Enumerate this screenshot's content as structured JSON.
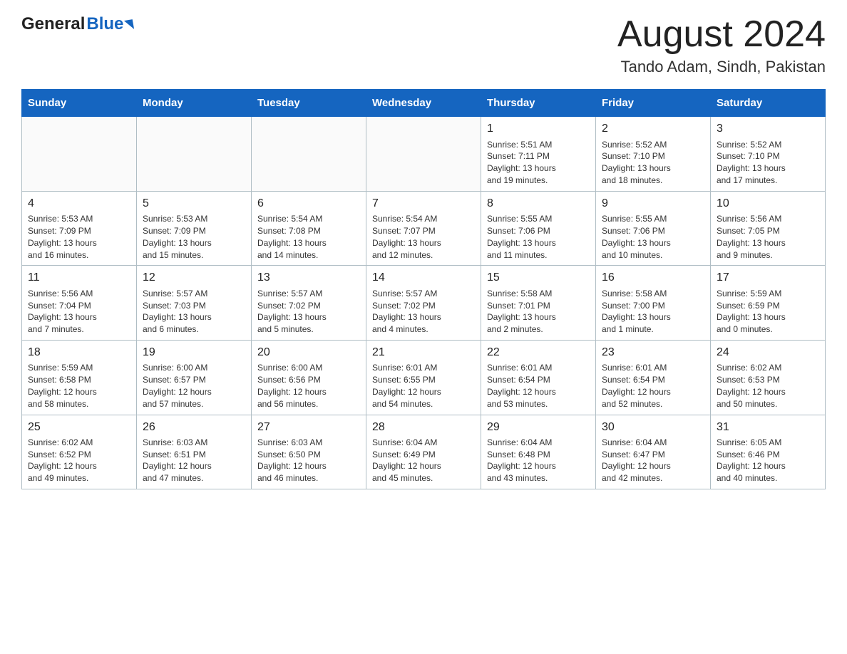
{
  "header": {
    "logo_general": "General",
    "logo_blue": "Blue",
    "month_title": "August 2024",
    "location": "Tando Adam, Sindh, Pakistan"
  },
  "days_of_week": [
    "Sunday",
    "Monday",
    "Tuesday",
    "Wednesday",
    "Thursday",
    "Friday",
    "Saturday"
  ],
  "weeks": [
    {
      "days": [
        {
          "num": "",
          "info": ""
        },
        {
          "num": "",
          "info": ""
        },
        {
          "num": "",
          "info": ""
        },
        {
          "num": "",
          "info": ""
        },
        {
          "num": "1",
          "info": "Sunrise: 5:51 AM\nSunset: 7:11 PM\nDaylight: 13 hours\nand 19 minutes."
        },
        {
          "num": "2",
          "info": "Sunrise: 5:52 AM\nSunset: 7:10 PM\nDaylight: 13 hours\nand 18 minutes."
        },
        {
          "num": "3",
          "info": "Sunrise: 5:52 AM\nSunset: 7:10 PM\nDaylight: 13 hours\nand 17 minutes."
        }
      ]
    },
    {
      "days": [
        {
          "num": "4",
          "info": "Sunrise: 5:53 AM\nSunset: 7:09 PM\nDaylight: 13 hours\nand 16 minutes."
        },
        {
          "num": "5",
          "info": "Sunrise: 5:53 AM\nSunset: 7:09 PM\nDaylight: 13 hours\nand 15 minutes."
        },
        {
          "num": "6",
          "info": "Sunrise: 5:54 AM\nSunset: 7:08 PM\nDaylight: 13 hours\nand 14 minutes."
        },
        {
          "num": "7",
          "info": "Sunrise: 5:54 AM\nSunset: 7:07 PM\nDaylight: 13 hours\nand 12 minutes."
        },
        {
          "num": "8",
          "info": "Sunrise: 5:55 AM\nSunset: 7:06 PM\nDaylight: 13 hours\nand 11 minutes."
        },
        {
          "num": "9",
          "info": "Sunrise: 5:55 AM\nSunset: 7:06 PM\nDaylight: 13 hours\nand 10 minutes."
        },
        {
          "num": "10",
          "info": "Sunrise: 5:56 AM\nSunset: 7:05 PM\nDaylight: 13 hours\nand 9 minutes."
        }
      ]
    },
    {
      "days": [
        {
          "num": "11",
          "info": "Sunrise: 5:56 AM\nSunset: 7:04 PM\nDaylight: 13 hours\nand 7 minutes."
        },
        {
          "num": "12",
          "info": "Sunrise: 5:57 AM\nSunset: 7:03 PM\nDaylight: 13 hours\nand 6 minutes."
        },
        {
          "num": "13",
          "info": "Sunrise: 5:57 AM\nSunset: 7:02 PM\nDaylight: 13 hours\nand 5 minutes."
        },
        {
          "num": "14",
          "info": "Sunrise: 5:57 AM\nSunset: 7:02 PM\nDaylight: 13 hours\nand 4 minutes."
        },
        {
          "num": "15",
          "info": "Sunrise: 5:58 AM\nSunset: 7:01 PM\nDaylight: 13 hours\nand 2 minutes."
        },
        {
          "num": "16",
          "info": "Sunrise: 5:58 AM\nSunset: 7:00 PM\nDaylight: 13 hours\nand 1 minute."
        },
        {
          "num": "17",
          "info": "Sunrise: 5:59 AM\nSunset: 6:59 PM\nDaylight: 13 hours\nand 0 minutes."
        }
      ]
    },
    {
      "days": [
        {
          "num": "18",
          "info": "Sunrise: 5:59 AM\nSunset: 6:58 PM\nDaylight: 12 hours\nand 58 minutes."
        },
        {
          "num": "19",
          "info": "Sunrise: 6:00 AM\nSunset: 6:57 PM\nDaylight: 12 hours\nand 57 minutes."
        },
        {
          "num": "20",
          "info": "Sunrise: 6:00 AM\nSunset: 6:56 PM\nDaylight: 12 hours\nand 56 minutes."
        },
        {
          "num": "21",
          "info": "Sunrise: 6:01 AM\nSunset: 6:55 PM\nDaylight: 12 hours\nand 54 minutes."
        },
        {
          "num": "22",
          "info": "Sunrise: 6:01 AM\nSunset: 6:54 PM\nDaylight: 12 hours\nand 53 minutes."
        },
        {
          "num": "23",
          "info": "Sunrise: 6:01 AM\nSunset: 6:54 PM\nDaylight: 12 hours\nand 52 minutes."
        },
        {
          "num": "24",
          "info": "Sunrise: 6:02 AM\nSunset: 6:53 PM\nDaylight: 12 hours\nand 50 minutes."
        }
      ]
    },
    {
      "days": [
        {
          "num": "25",
          "info": "Sunrise: 6:02 AM\nSunset: 6:52 PM\nDaylight: 12 hours\nand 49 minutes."
        },
        {
          "num": "26",
          "info": "Sunrise: 6:03 AM\nSunset: 6:51 PM\nDaylight: 12 hours\nand 47 minutes."
        },
        {
          "num": "27",
          "info": "Sunrise: 6:03 AM\nSunset: 6:50 PM\nDaylight: 12 hours\nand 46 minutes."
        },
        {
          "num": "28",
          "info": "Sunrise: 6:04 AM\nSunset: 6:49 PM\nDaylight: 12 hours\nand 45 minutes."
        },
        {
          "num": "29",
          "info": "Sunrise: 6:04 AM\nSunset: 6:48 PM\nDaylight: 12 hours\nand 43 minutes."
        },
        {
          "num": "30",
          "info": "Sunrise: 6:04 AM\nSunset: 6:47 PM\nDaylight: 12 hours\nand 42 minutes."
        },
        {
          "num": "31",
          "info": "Sunrise: 6:05 AM\nSunset: 6:46 PM\nDaylight: 12 hours\nand 40 minutes."
        }
      ]
    }
  ]
}
